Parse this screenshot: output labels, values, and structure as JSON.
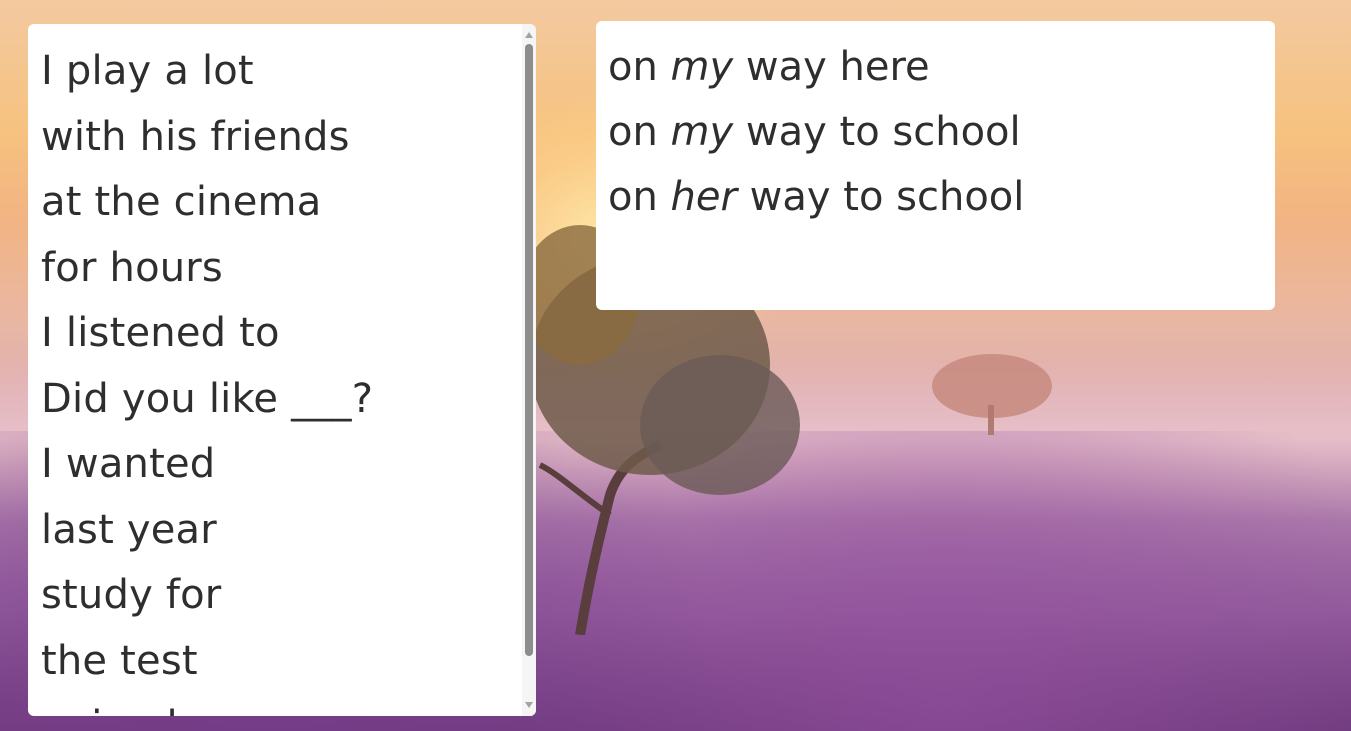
{
  "left_list": {
    "items": [
      "I play a lot",
      "with his friends",
      "at the cinema",
      "for hours",
      "I listened to",
      "Did you like ___?",
      "I wanted",
      "last year",
      "study for",
      "the test",
      "going home"
    ]
  },
  "right_list": {
    "items": [
      {
        "pre": "on ",
        "em": "my",
        "post": " way here"
      },
      {
        "pre": "on ",
        "em": "my",
        "post": " way to school"
      },
      {
        "pre": "on ",
        "em": "her",
        "post": " way to school"
      }
    ]
  },
  "colors": {
    "panel_bg": "#ffffff",
    "text": "#2e2e2e",
    "scroll_thumb": "#8d8d8d"
  }
}
